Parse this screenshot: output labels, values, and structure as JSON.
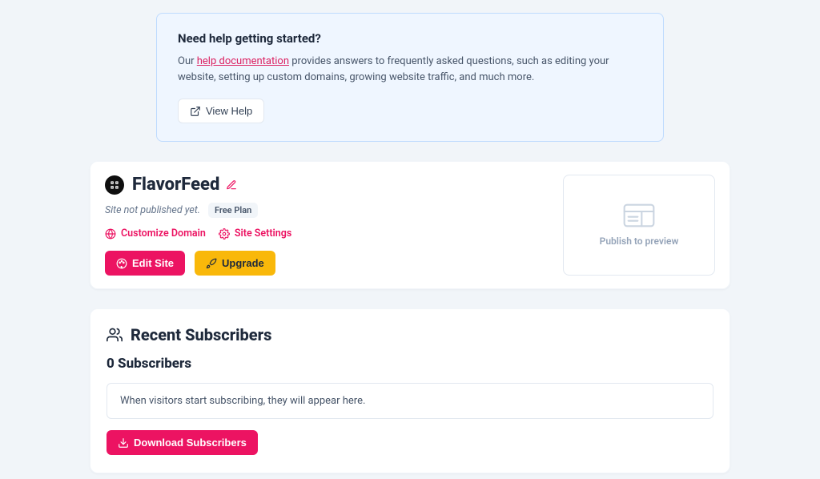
{
  "help": {
    "title": "Need help getting started?",
    "prefix": "Our ",
    "link_text": "help documentation",
    "suffix": " provides answers to frequently asked questions, such as editing your website, setting up custom domains, growing website traffic, and much more.",
    "button": "View Help"
  },
  "site": {
    "name": "FlavorFeed",
    "status": "Site not published yet.",
    "plan": "Free Plan",
    "links": {
      "customize_domain": "Customize Domain",
      "site_settings": "Site Settings"
    },
    "buttons": {
      "edit_site": "Edit Site",
      "upgrade": "Upgrade"
    },
    "preview_label": "Publish to preview"
  },
  "subscribers": {
    "heading": "Recent Subscribers",
    "count_label": "0 Subscribers",
    "empty": "When visitors start subscribing, they will appear here.",
    "download": "Download Subscribers"
  }
}
